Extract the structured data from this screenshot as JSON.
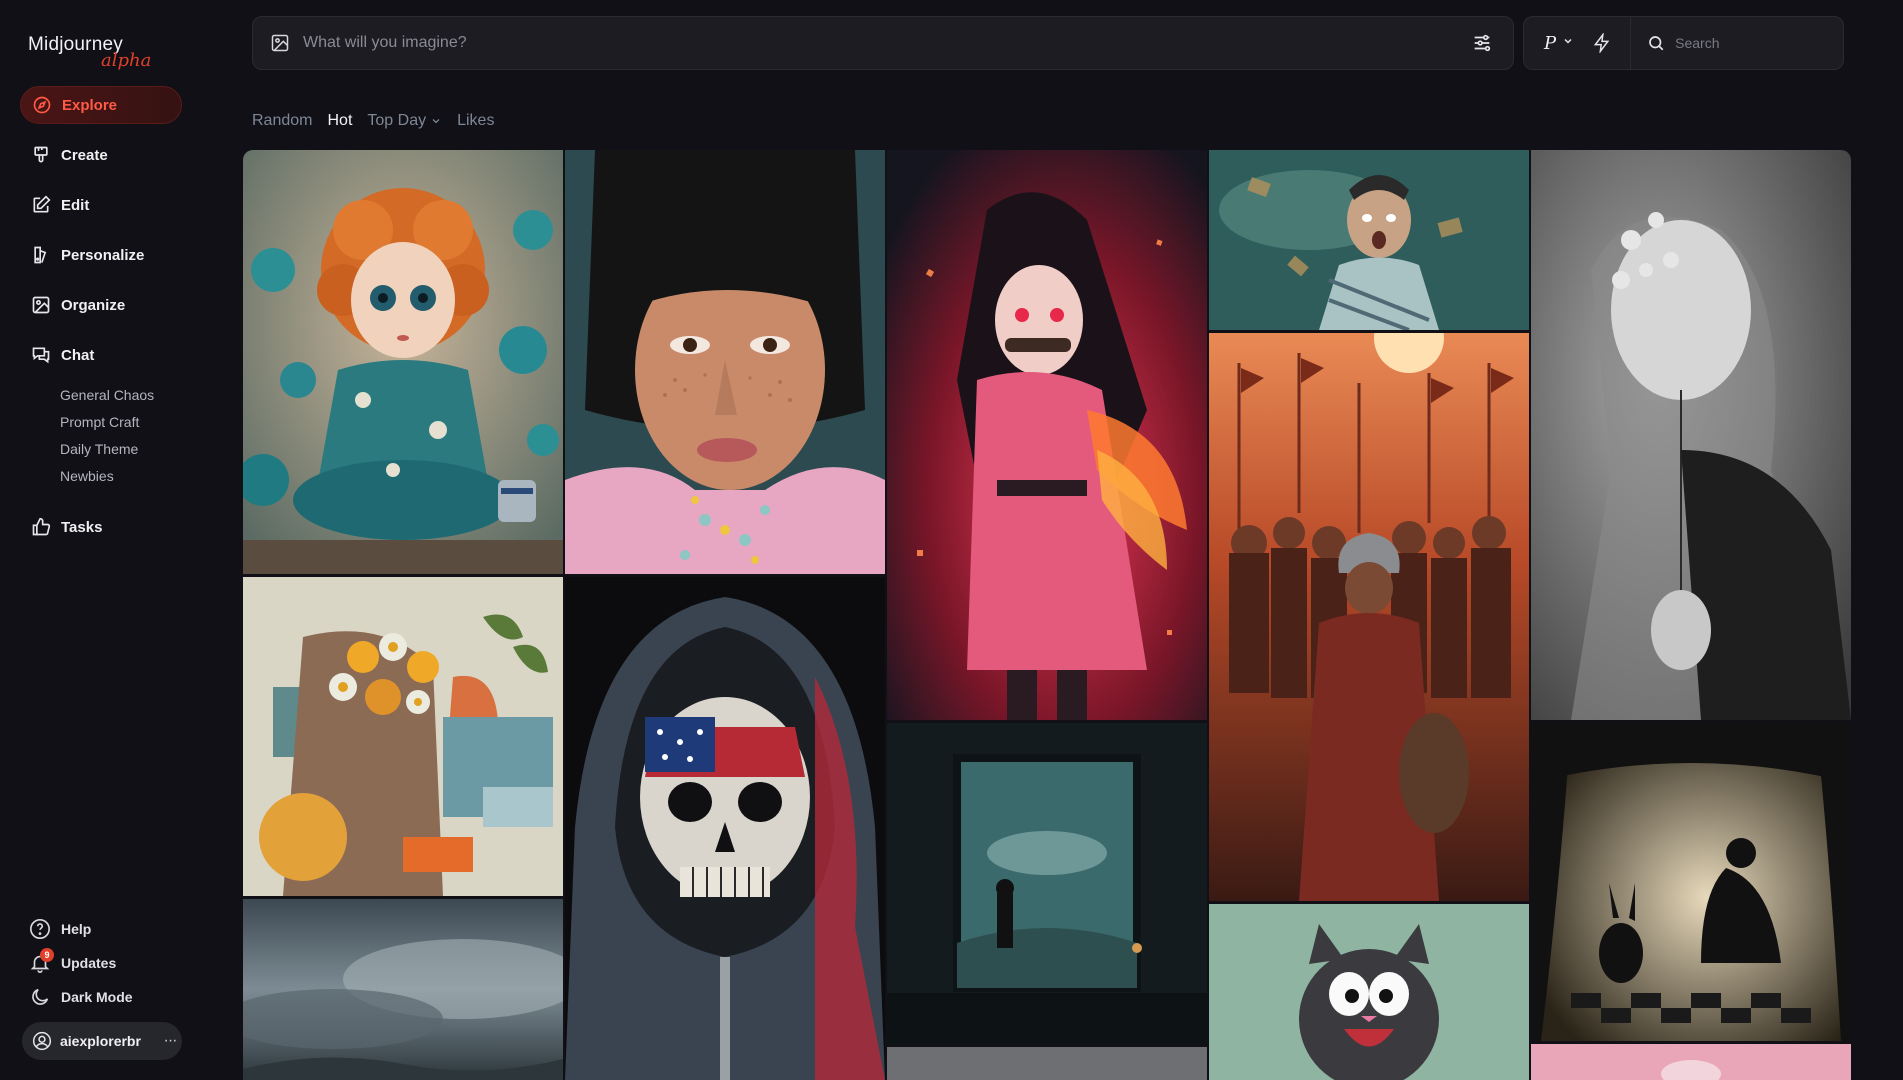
{
  "app": {
    "name": "Midjourney",
    "tag": "alpha"
  },
  "sidebar": {
    "items": [
      {
        "label": "Explore",
        "icon": "compass-icon"
      },
      {
        "label": "Create",
        "icon": "brush-icon"
      },
      {
        "label": "Edit",
        "icon": "edit-icon"
      },
      {
        "label": "Personalize",
        "icon": "personalize-icon"
      },
      {
        "label": "Organize",
        "icon": "image-icon"
      },
      {
        "label": "Chat",
        "icon": "chat-icon"
      }
    ],
    "chat_rooms": [
      "General Chaos",
      "Prompt Craft",
      "Daily Theme",
      "Newbies"
    ],
    "tasks": {
      "label": "Tasks",
      "icon": "thumbs-up-icon"
    },
    "bottom": {
      "help": "Help",
      "updates": "Updates",
      "updates_badge": "9",
      "dark_mode": "Dark Mode"
    },
    "user": {
      "name": "aiexplorerbr",
      "more": "···"
    }
  },
  "prompt": {
    "placeholder": "What will you imagine?"
  },
  "toolbar": {
    "personalize_letter": "P",
    "search_placeholder": "Search"
  },
  "tabs": [
    {
      "label": "Random",
      "active": false
    },
    {
      "label": "Hot",
      "active": true
    },
    {
      "label": "Top Day",
      "active": false,
      "has_dropdown": true
    },
    {
      "label": "Likes",
      "active": false
    }
  ],
  "colors": {
    "accent": "#e0402a",
    "background": "#101016",
    "panel": "#1c1c22"
  },
  "gallery": [
    {
      "name": "doll-kimono-image"
    },
    {
      "name": "freckled-woman-portrait-image"
    },
    {
      "name": "anime-girl-red-image"
    },
    {
      "name": "underwater-man-image"
    },
    {
      "name": "woman-flowers-bw-image"
    },
    {
      "name": "collage-flowers-head-image"
    },
    {
      "name": "flag-skull-hoodie-image"
    },
    {
      "name": "aquarium-window-image"
    },
    {
      "name": "warrior-army-image"
    },
    {
      "name": "shadow-puppet-alice-image"
    },
    {
      "name": "stormy-sky-image"
    },
    {
      "name": "gray-landscape-image"
    },
    {
      "name": "cartoon-cat-image"
    },
    {
      "name": "pink-dessert-image"
    }
  ]
}
